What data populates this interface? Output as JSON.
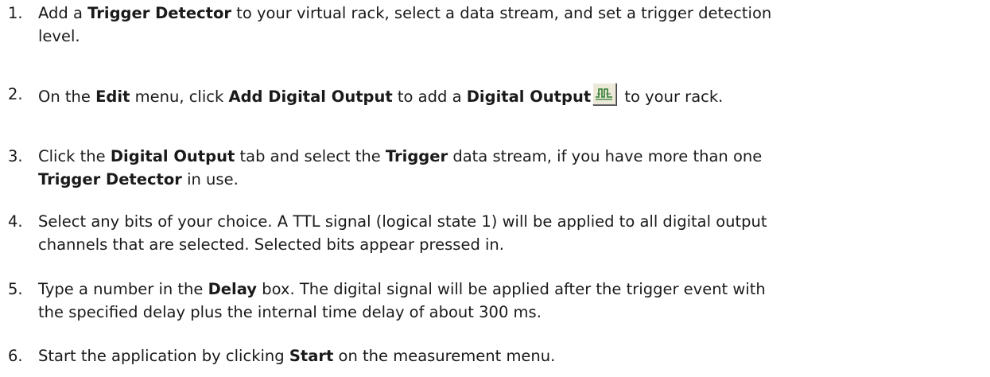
{
  "steps": [
    {
      "number": "1.",
      "pre": "Add a ",
      "b1": "Trigger Detector",
      "post": " to your virtual rack, select a data stream, and set a trigger detection",
      "line2": "level."
    },
    {
      "number": "2.",
      "pre": "On the ",
      "b1": "Edit",
      "mid1": " menu, click ",
      "b2": "Add Digital Output",
      "mid2": " to add a ",
      "b3": "Digital Output",
      "post": " to your rack.",
      "icon": "digital-output-icon"
    },
    {
      "number": "3.",
      "pre": "Click the ",
      "b1": "Digital Output",
      "mid1": " tab and select the ",
      "b2": "Trigger",
      "post": " data stream, if you have more than one",
      "line2_b": "Trigger Detector",
      "line2_post": " in use."
    },
    {
      "number": "4.",
      "text": "Select any bits of your choice. A TTL signal (logical state 1) will be applied to all digital output",
      "line2": "channels that are selected. Selected bits appear pressed in."
    },
    {
      "number": "5.",
      "pre": "Type a number in the ",
      "b1": "Delay",
      "post": " box. The digital signal will be applied after the trigger event with",
      "line2": "the specified delay plus the internal time delay of about 300 ms."
    },
    {
      "number": "6.",
      "pre": "Start the application by clicking ",
      "b1": "Start",
      "post": " on the measurement menu."
    }
  ]
}
